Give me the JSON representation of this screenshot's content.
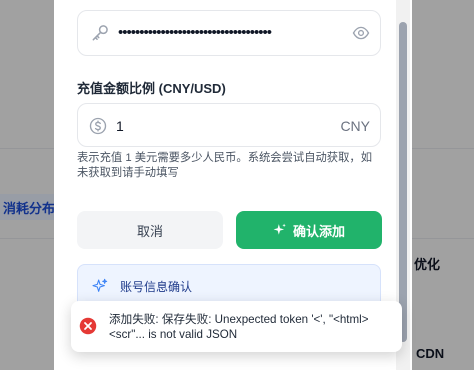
{
  "background": {
    "left_label": "消耗分布",
    "right_label_top": "优化",
    "right_label_bottom": "CDN"
  },
  "modal": {
    "password_field": {
      "value_masked": "••••••••••••••••••••••••••••••••••••"
    },
    "rate_field": {
      "label": "充值金额比例 (CNY/USD)",
      "value": "1",
      "unit": "CNY",
      "help_text": "表示充值 1 美元需要多少人民币。系统会尝试自动获取，如未获取到请手动填写"
    },
    "buttons": {
      "cancel": "取消",
      "confirm": "确认添加"
    },
    "info_card": {
      "title": "账号信息确认"
    }
  },
  "toast": {
    "message": "添加失败: 保存失败: Unexpected token '<', \"<html> <scr\"... is not valid JSON",
    "type": "error"
  },
  "colors": {
    "accent_green": "#21b36b",
    "error_red": "#e53935",
    "info_blue": "#1e3a8a"
  }
}
